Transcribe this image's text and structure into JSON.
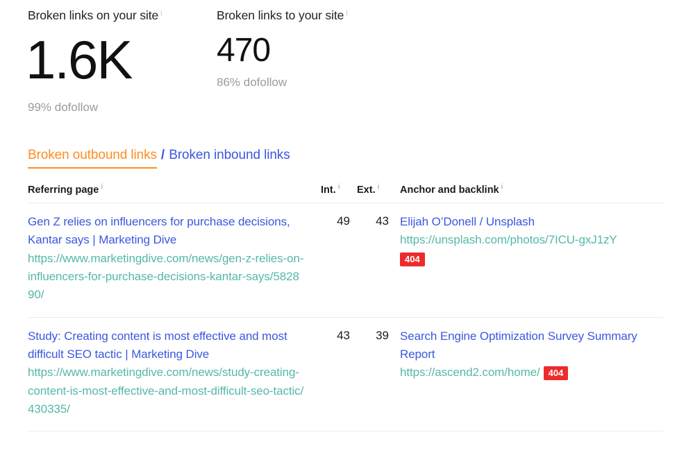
{
  "metrics": [
    {
      "label": "Broken links on your site",
      "info_icon": "info-icon",
      "value": "1.6K",
      "sub": "99% dofollow"
    },
    {
      "label": "Broken links to your site",
      "info_icon": "info-icon",
      "value": "470",
      "sub": "86% dofollow"
    }
  ],
  "tabs": {
    "active_label": "Broken outbound links",
    "separator": "/",
    "inactive_label": "Broken inbound links",
    "active_color": "#ff8c20",
    "inactive_color": "#3b57e0"
  },
  "table": {
    "headers": {
      "referring_page": "Referring page",
      "internal": "Int.",
      "external": "Ext.",
      "anchor": "Anchor and backlink"
    },
    "rows": [
      {
        "referring_title": "Gen Z relies on influencers for purchase decisions, Kantar says | Marketing Dive",
        "referring_url": "https://www.marketingdive.com/news/gen-z-relies-on-influencers-for-purchase-decisions-kantar-says/582890/",
        "internal": "49",
        "external": "43",
        "anchor_text": "Elijah O’Donell / Unsplash",
        "anchor_url": "https://unsplash.com/photos/7ICU-gxJ1zY",
        "status_code": "404",
        "badge_inline": false
      },
      {
        "referring_title": "Study: Creating content is most effective and most difficult SEO tactic | Marketing Dive",
        "referring_url": "https://www.marketingdive.com/news/study-creating-content-is-most-effective-and-most-difficult-seo-tactic/430335/",
        "internal": "43",
        "external": "39",
        "anchor_text": "Search Engine Optimization Survey Summary Report",
        "anchor_url": "https://ascend2.com/home/",
        "status_code": "404",
        "badge_inline": true
      }
    ]
  },
  "colors": {
    "link_blue": "#3b57e0",
    "url_teal": "#55b8a8",
    "accent_orange": "#ff8c20",
    "status_red": "#ee2b2b",
    "muted_gray": "#9b9b9b",
    "divider": "#ececec"
  }
}
